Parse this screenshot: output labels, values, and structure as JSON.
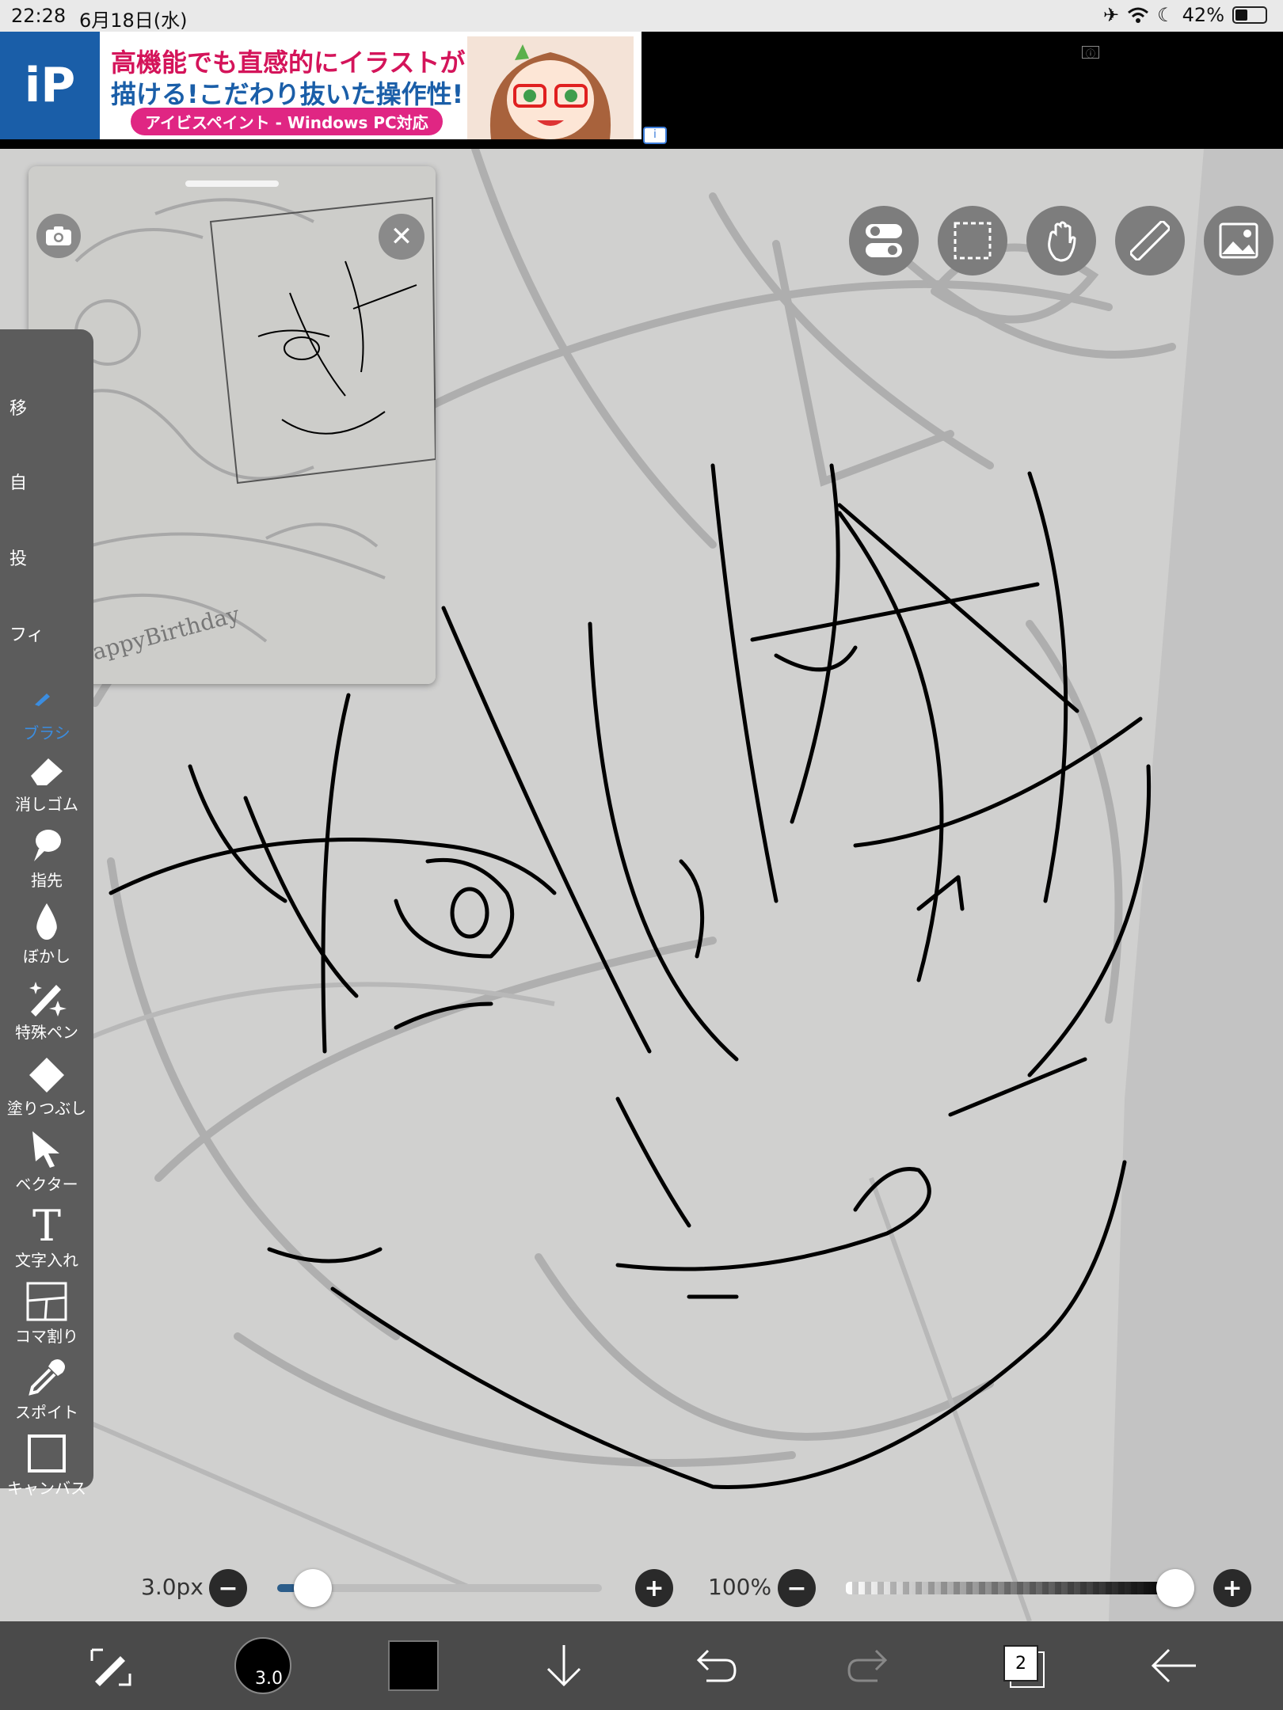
{
  "status_bar": {
    "time": "22:28",
    "date": "6月18日(水)",
    "battery": "42%",
    "battery_level": 0.42
  },
  "ad": {
    "logo": "iP",
    "line1": "高機能でも直感的にイラストが",
    "line2": "描ける!こだわり抜いた操作性!",
    "line3": "アイビスペイント - Windows PC対応",
    "info_label": "i",
    "close_label": "ⓘ"
  },
  "navigator": {
    "camera_icon": "camera-icon",
    "close_icon": "close-icon",
    "thumbnail_text": "HappyBirthday"
  },
  "toolbar": {
    "hidden_labels": [
      "移",
      "自",
      "投",
      "フィ"
    ],
    "tools": [
      {
        "label": "ブラシ",
        "icon": "brush-icon",
        "active": true
      },
      {
        "label": "消しゴム",
        "icon": "eraser-icon",
        "active": false
      },
      {
        "label": "指先",
        "icon": "smudge-icon",
        "active": false
      },
      {
        "label": "ぼかし",
        "icon": "blur-icon",
        "active": false
      },
      {
        "label": "特殊ペン",
        "icon": "special-pen-icon",
        "active": false
      },
      {
        "label": "塗りつぶし",
        "icon": "fill-icon",
        "active": false
      },
      {
        "label": "ベクター",
        "icon": "vector-icon",
        "active": false
      },
      {
        "label": "文字入れ",
        "icon": "text-icon",
        "active": false
      },
      {
        "label": "コマ割り",
        "icon": "frame-divider-icon",
        "active": false
      },
      {
        "label": "スポイト",
        "icon": "eyedropper-icon",
        "active": false
      },
      {
        "label": "キャンバス",
        "icon": "canvas-icon",
        "active": false
      }
    ]
  },
  "top_right_buttons": [
    "toggle-icon",
    "selection-icon",
    "hand-gesture-icon",
    "ruler-icon",
    "image-icon"
  ],
  "brush_settings": {
    "size_label": "3.0px",
    "size_value": 3.0,
    "size_slider_fraction": 0.06,
    "opacity_label": "100%",
    "opacity_fraction": 1.0,
    "minus": "−",
    "plus": "+"
  },
  "bottom_bar": {
    "brush_size_badge": "3.0",
    "layer_count": "2",
    "current_color": "#000000",
    "icons": [
      "transform-tool-icon",
      "brush-size-icon",
      "color-icon",
      "import-icon",
      "undo-icon",
      "redo-icon",
      "layers-icon",
      "back-icon"
    ]
  }
}
